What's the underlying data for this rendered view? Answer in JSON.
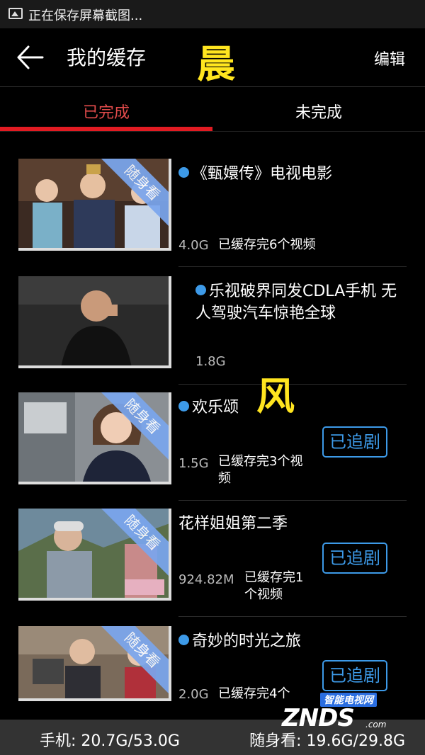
{
  "status_bar": {
    "text": "正在保存屏幕截图..."
  },
  "header": {
    "title": "我的缓存",
    "edit_label": "编辑"
  },
  "watermarks": {
    "top": "晨",
    "middle": "风",
    "logo_cn": "智能电视网",
    "logo_en": "ZNDS",
    "logo_suffix": ".com"
  },
  "tabs": {
    "done": "已完成",
    "pending": "未完成",
    "active": "done"
  },
  "items": [
    {
      "title": "《甄嬛传》电视电影",
      "size": "4.0G",
      "cache": "已缓存完6个视频",
      "badge": "随身看",
      "dot": true,
      "follow": ""
    },
    {
      "title": "乐视破界同发CDLA手机 无人驾驶汽车惊艳全球",
      "size": "1.8G",
      "cache": "",
      "badge": "",
      "dot": true,
      "follow": ""
    },
    {
      "title": "欢乐颂",
      "size": "1.5G",
      "cache": "已缓存完3个视频",
      "badge": "随身看",
      "dot": true,
      "follow": "已追剧"
    },
    {
      "title": "花样姐姐第二季",
      "size": "924.82M",
      "cache": "已缓存完1个视频",
      "badge": "随身看",
      "dot": false,
      "follow": "已追剧"
    },
    {
      "title": "奇妙的时光之旅",
      "size": "2.0G",
      "cache": "已缓存完4个",
      "badge": "随身看",
      "dot": true,
      "follow": "已追剧"
    }
  ],
  "footer": {
    "phone_storage": "手机: 20.7G/53.0G",
    "portable_storage": "随身看: 19.6G/29.8G"
  },
  "icons": [
    "image-icon",
    "back-arrow-icon"
  ],
  "colors": {
    "accent_red": "#e11b22",
    "tab_active": "#e24b4b",
    "blue": "#3d9ae8",
    "badge": "#7aa6ee"
  }
}
